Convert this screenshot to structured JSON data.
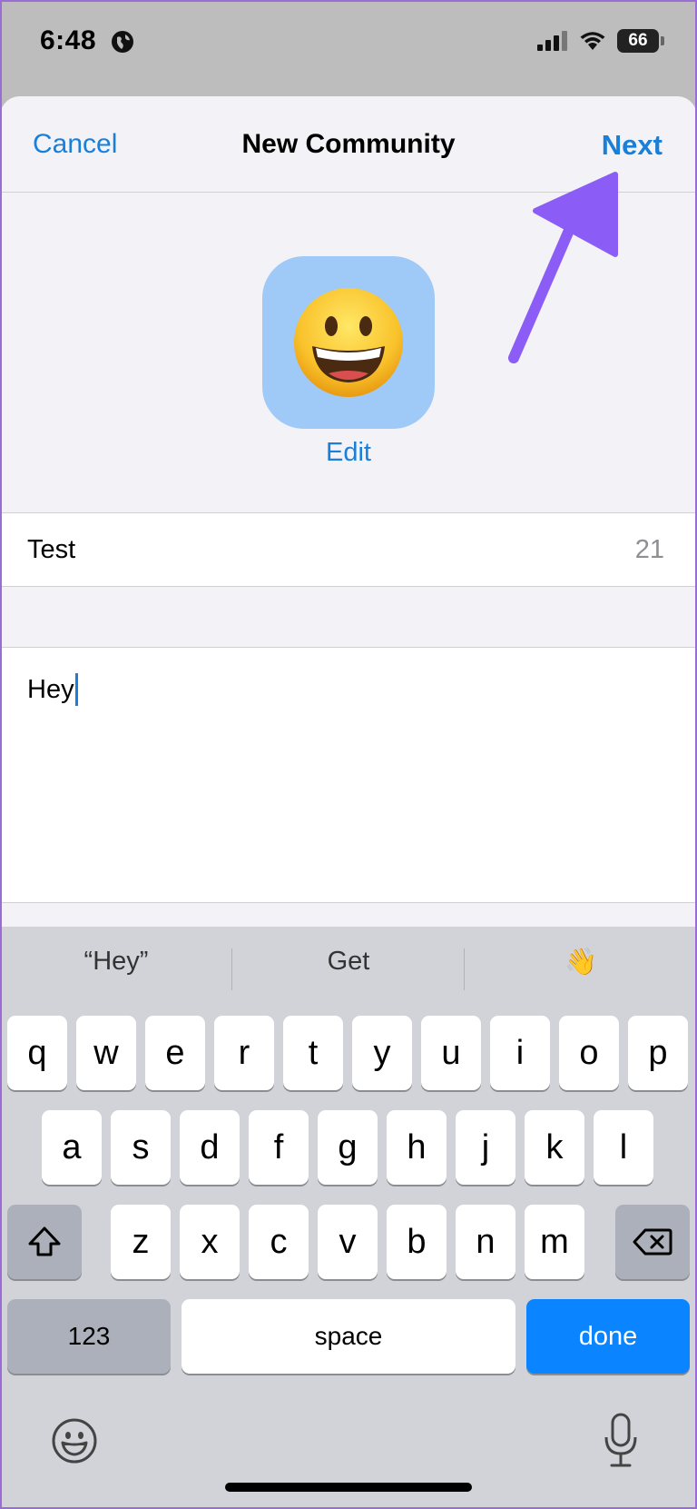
{
  "status_bar": {
    "time": "6:48",
    "battery": "66",
    "icons": [
      "globe-icon",
      "signal-icon",
      "wifi-icon",
      "battery-icon"
    ]
  },
  "nav": {
    "cancel_label": "Cancel",
    "title": "New Community",
    "next_label": "Next"
  },
  "avatar": {
    "emoji": "😀",
    "edit_label": "Edit",
    "background": "#9fc9f7"
  },
  "form": {
    "name_value": "Test",
    "name_remaining": "21",
    "description_value": "Hey"
  },
  "keyboard": {
    "suggestions": [
      "“Hey”",
      "Get",
      "👋"
    ],
    "row1": [
      "q",
      "w",
      "e",
      "r",
      "t",
      "y",
      "u",
      "i",
      "o",
      "p"
    ],
    "row2": [
      "a",
      "s",
      "d",
      "f",
      "g",
      "h",
      "j",
      "k",
      "l"
    ],
    "row3": [
      "z",
      "x",
      "c",
      "v",
      "b",
      "n",
      "m"
    ],
    "numbers_label": "123",
    "space_label": "space",
    "done_label": "done"
  },
  "colors": {
    "accent": "#1a7fd8",
    "done_key": "#0a84ff",
    "annotation_arrow": "#8b5cf6"
  }
}
